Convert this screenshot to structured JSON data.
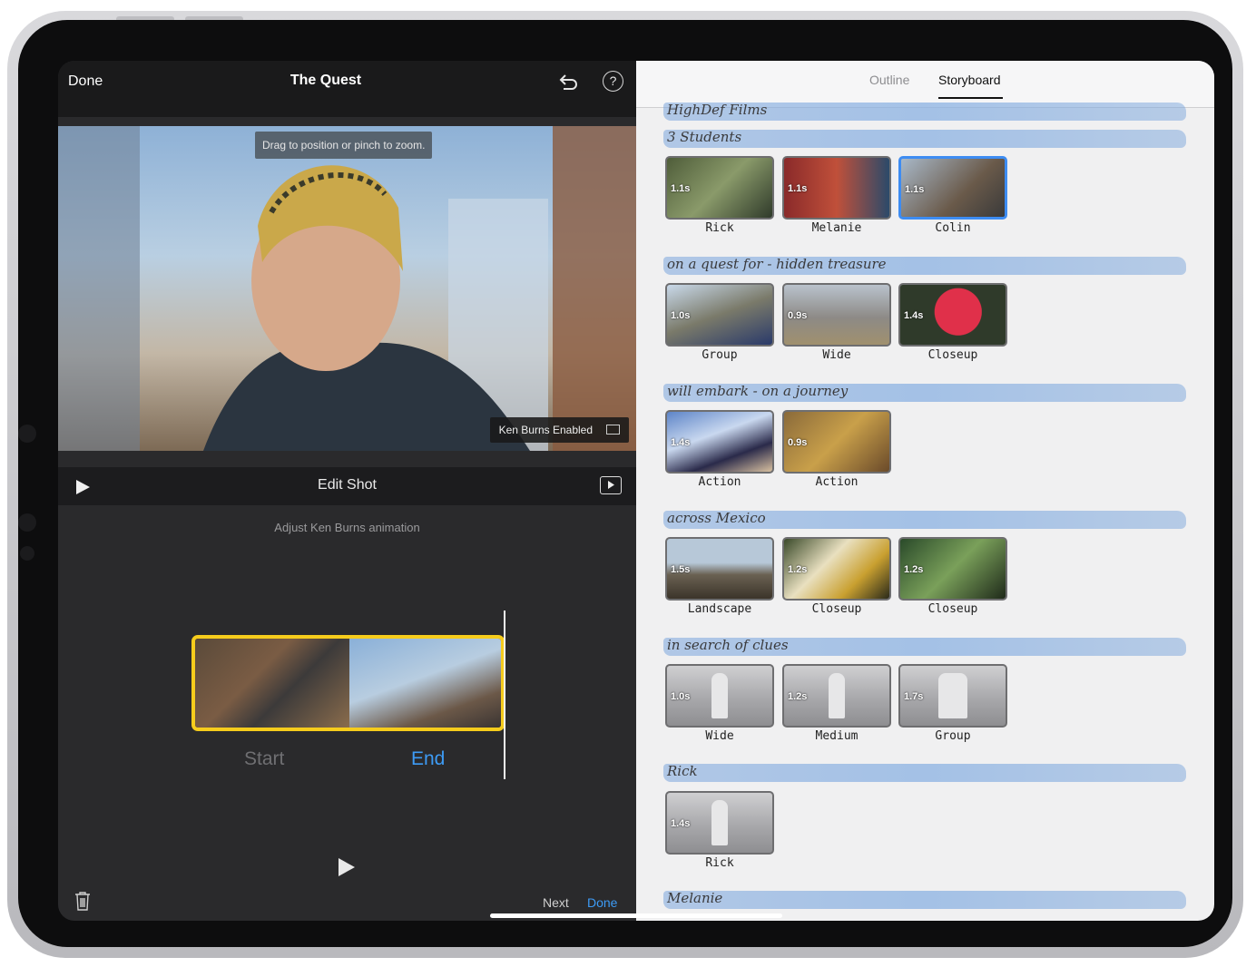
{
  "left": {
    "nav": {
      "done": "Done",
      "title": "The Quest"
    },
    "viewer": {
      "tip": "Drag to position or pinch to zoom.",
      "ken_burns": "Ken Burns Enabled"
    },
    "edit": {
      "title": "Edit Shot",
      "subtitle": "Adjust Ken Burns animation",
      "start": "Start",
      "end": "End"
    },
    "footer": {
      "next": "Next",
      "done": "Done"
    }
  },
  "right": {
    "tabs": {
      "outline": "Outline",
      "storyboard": "Storyboard"
    },
    "sections": [
      {
        "heading": "HighDef Films",
        "shots": []
      },
      {
        "heading": "3 Students",
        "shots": [
          {
            "dur": "1.1s",
            "name": "Rick"
          },
          {
            "dur": "1.1s",
            "name": "Melanie"
          },
          {
            "dur": "1.1s",
            "name": "Colin"
          }
        ]
      },
      {
        "heading": "on a quest for - hidden treasure",
        "shots": [
          {
            "dur": "1.0s",
            "name": "Group"
          },
          {
            "dur": "0.9s",
            "name": "Wide"
          },
          {
            "dur": "1.4s",
            "name": "Closeup"
          }
        ]
      },
      {
        "heading": "will embark - on a journey",
        "shots": [
          {
            "dur": "1.4s",
            "name": "Action"
          },
          {
            "dur": "0.9s",
            "name": "Action"
          }
        ]
      },
      {
        "heading": "across Mexico",
        "shots": [
          {
            "dur": "1.5s",
            "name": "Landscape"
          },
          {
            "dur": "1.2s",
            "name": "Closeup"
          },
          {
            "dur": "1.2s",
            "name": "Closeup"
          }
        ]
      },
      {
        "heading": "in search of clues",
        "shots": [
          {
            "dur": "1.0s",
            "name": "Wide"
          },
          {
            "dur": "1.2s",
            "name": "Medium"
          },
          {
            "dur": "1.7s",
            "name": "Group"
          }
        ]
      },
      {
        "heading": "Rick",
        "shots": [
          {
            "dur": "1.4s",
            "name": "Rick"
          }
        ]
      },
      {
        "heading": "Melanie",
        "shots": []
      }
    ]
  },
  "colors": {
    "accent": "#3d9bf5",
    "selection": "#f6cc1c",
    "selected_shot": "#3d8cf2"
  }
}
